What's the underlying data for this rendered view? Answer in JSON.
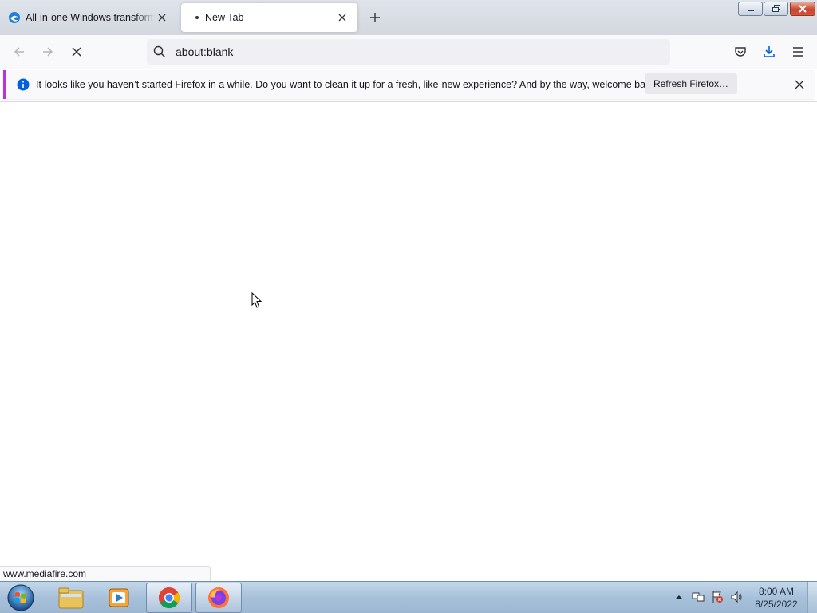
{
  "tabs": [
    {
      "title": "All-in-one Windows transforma",
      "favicon": "edge-logo-icon",
      "active": false
    },
    {
      "title": "New Tab",
      "favicon": "loading-dot-icon",
      "active": true
    }
  ],
  "urlbar": {
    "value": "about:blank"
  },
  "notification": {
    "message": "It looks like you haven’t started Firefox in a while. Do you want to clean it up for a fresh, like-new experience? And by the way, welcome back!",
    "button_label": "Refresh Firefox…",
    "accent_color": "#b833e1"
  },
  "status": {
    "url": "www.mediafire.com"
  },
  "taskbar": {
    "apps": [
      "file-explorer-icon",
      "media-player-icon",
      "chrome-icon",
      "firefox-icon"
    ],
    "clock": {
      "time": "8:00 AM",
      "date": "8/25/2022"
    }
  }
}
